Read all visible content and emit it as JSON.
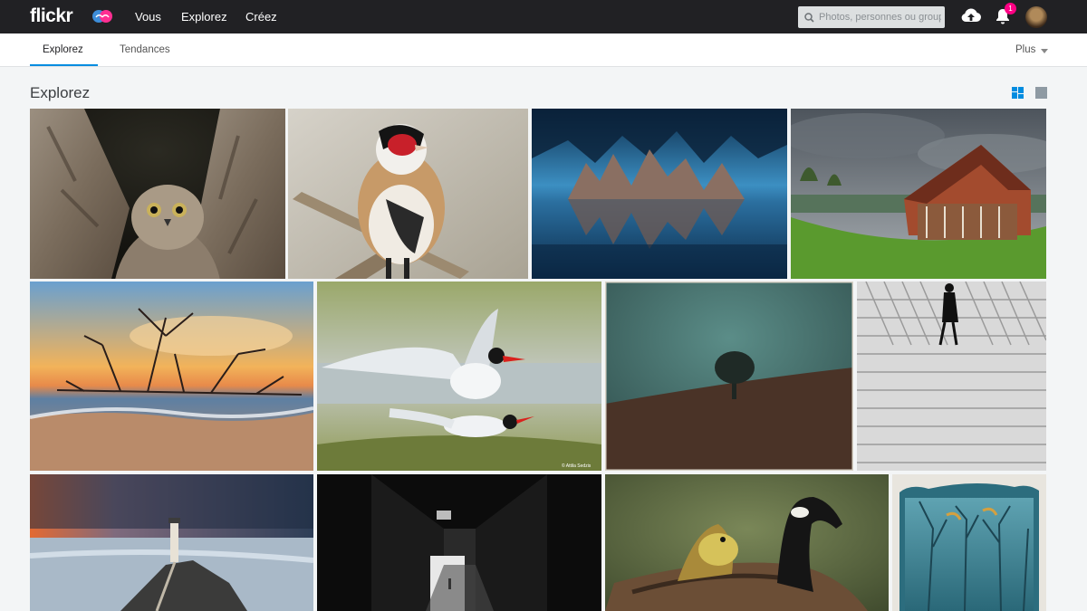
{
  "header": {
    "logo": "flickr",
    "nav": [
      "Vous",
      "Explorez",
      "Créez"
    ],
    "search_placeholder": "Photos, personnes ou groupes",
    "notifications_count": "1",
    "icons": [
      "pro-badge-icon",
      "search-icon",
      "upload-cloud-icon",
      "bell-icon"
    ]
  },
  "subnav": {
    "tabs": [
      "Explorez",
      "Tendances"
    ],
    "active_tab": "Explorez",
    "more_label": "Plus"
  },
  "page": {
    "title": "Explorez",
    "view_modes": [
      "justified-grid",
      "single-photo"
    ],
    "active_view": "justified-grid"
  },
  "colors": {
    "topbar": "#212124",
    "accent": "#008ce0",
    "badge": "#ff0084",
    "background": "#f3f5f6"
  },
  "photos": [
    "owl-chick",
    "goldfinch",
    "ice-cave",
    "timber-house",
    "sunset-driftwood",
    "terns",
    "lone-tree",
    "man-on-boardwalk",
    "lighthouse",
    "dark-tunnel",
    "goose-and-gosling",
    "polaroid-trees"
  ],
  "watermarks": [
    "© Attila Sedzis"
  ]
}
